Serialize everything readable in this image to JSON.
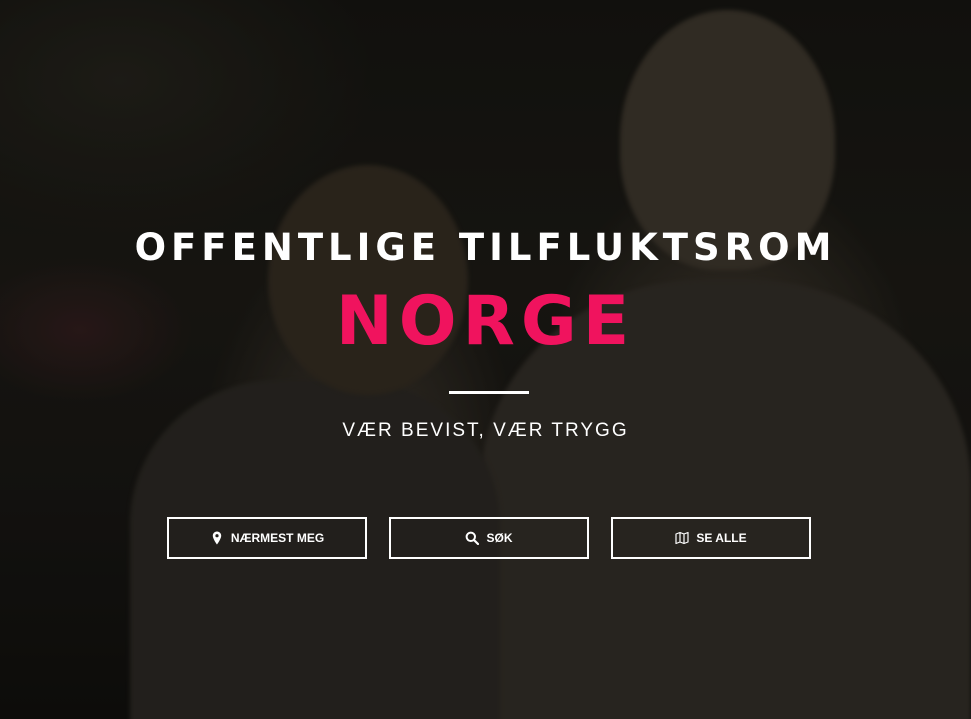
{
  "hero": {
    "title_top": "OFFENTLIGE TILFLUKTSROM",
    "title_main": "NORGE",
    "tagline": "VÆR BEVIST, VÆR TRYGG",
    "accent_color": "#f0135e"
  },
  "buttons": [
    {
      "label": "NÆRMEST MEG",
      "icon": "map-marker-icon"
    },
    {
      "label": "SØK",
      "icon": "search-icon"
    },
    {
      "label": "SE ALLE",
      "icon": "map-icon"
    }
  ]
}
